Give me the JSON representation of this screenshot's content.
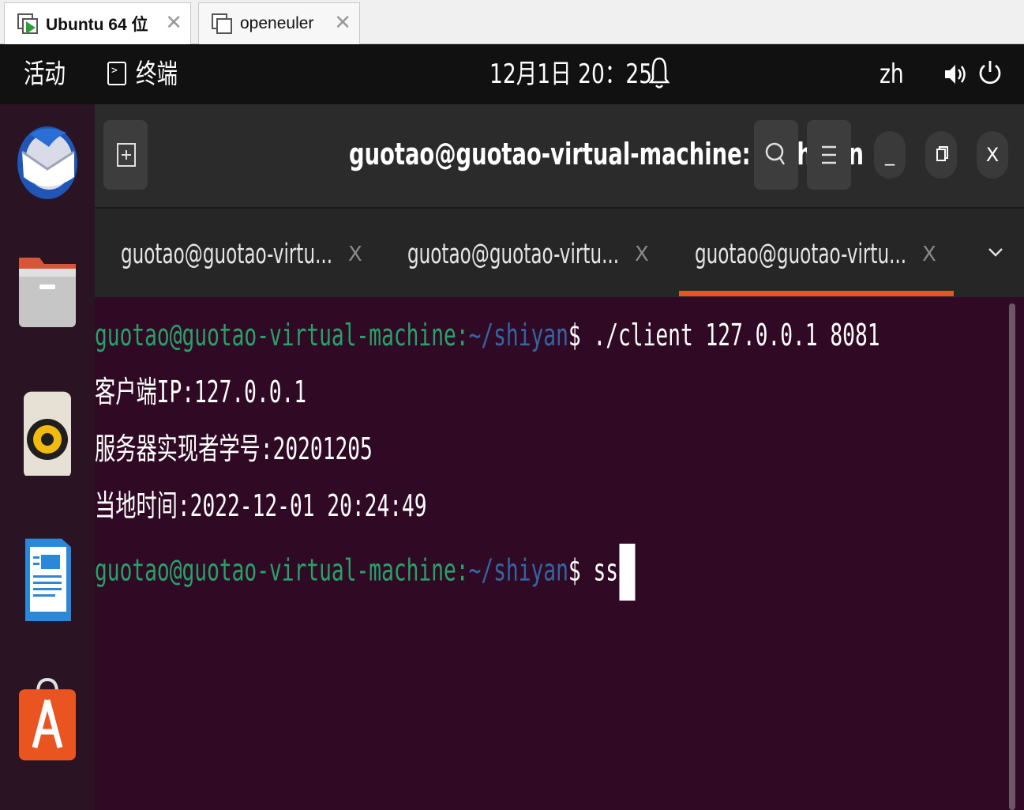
{
  "vm_tabs": [
    {
      "label": "Ubuntu 64 位",
      "active": true
    },
    {
      "label": "openeuler",
      "active": false
    }
  ],
  "topbar": {
    "activities": "活动",
    "app_name": "终端",
    "clock": "12月1日 20：25",
    "input_method": "zh"
  },
  "dock_icons": [
    "thunderbird-icon",
    "files-icon",
    "rhythmbox-icon",
    "libreoffice-writer-icon",
    "software-center-icon"
  ],
  "terminal": {
    "title": "guotao@guotao-virtual-machine: ~/shiyan",
    "tabs": [
      {
        "label": "guotao@guotao-virtu...",
        "close": "X"
      },
      {
        "label": "guotao@guotao-virtu...",
        "close": "X"
      },
      {
        "label": "guotao@guotao-virtu...",
        "close": "X",
        "active": true
      }
    ],
    "prompt_user": "guotao@guotao-virtual-machine:",
    "prompt_path": "~/shiyan",
    "prompt_symbol": "$",
    "lines": {
      "cmd1": " ./client 127.0.0.1 8081",
      "out1": "客户端IP:127.0.0.1",
      "out2": "服务器实现者学号:20201205",
      "out3": "当地时间:2022-12-01 20:24:49",
      "cmd2": " ss"
    },
    "buttons": {
      "minimize": "_",
      "close": "X"
    }
  },
  "colors": {
    "terminal_bg": "#300a24",
    "prompt_user": "#26a269",
    "prompt_path": "#3465a4",
    "accent": "#e95420"
  }
}
